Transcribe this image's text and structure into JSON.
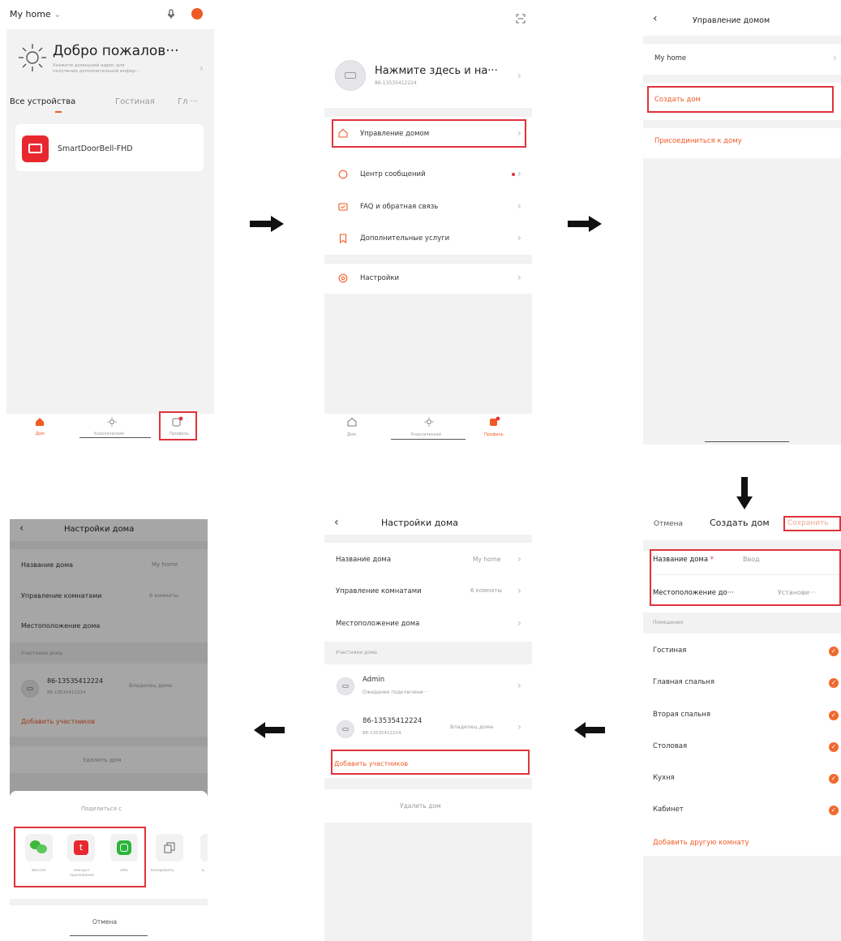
{
  "colors": {
    "accent": "#ef5a24",
    "highlight": "#e0333b"
  },
  "p1": {
    "home_selector": "My home",
    "chevron": "⌄",
    "welcome": "Добро пожалов···",
    "welcome_sub1": "Укажите домашний адрес для",
    "welcome_sub2": "получения дополнительной инфор···",
    "tabs": [
      "Все устройства",
      "Гостиная",
      "Гл ···"
    ],
    "device_name": "SmartDoorBell-FHD",
    "nav": [
      "Дом",
      "Классический",
      "Профиль"
    ]
  },
  "p2": {
    "profile_title": "Нажмите здесь и на···",
    "profile_sub": "86-13535412224",
    "menu": [
      "Управление домом",
      "Центр сообщений",
      "FAQ и обратная связь",
      "Дополнительные услуги"
    ],
    "settings": "Настройки",
    "nav": [
      "Дом",
      "Классический",
      "Профиль"
    ]
  },
  "p3": {
    "title": "Управление домом",
    "home": "My home",
    "create": "Создать дом",
    "join": "Присоединиться к дому"
  },
  "p4": {
    "cancel": "Отмена",
    "title": "Создать дом",
    "save": "Сохранить",
    "name_label": "Название дома",
    "name_placeholder": "Ввод",
    "location_label": "Местоположение до···",
    "location_value": "Установи···",
    "rooms_header": "Помещения",
    "rooms": [
      "Гостиная",
      "Главная спальня",
      "Вторая спальня",
      "Столовая",
      "Кухня",
      "Кабинет"
    ],
    "add_room": "Добавить другую комнату"
  },
  "p5": {
    "title": "Настройки дома",
    "home_name_label": "Название дома",
    "home_name_value": "My home",
    "rooms_label": "Управление комнатами",
    "rooms_value": "6 комнаты",
    "location_label": "Местоположение дома",
    "members_header": "Участники дома",
    "member1_name": "Admin",
    "member1_sub": "Ожидание подключени···",
    "member2_name": "86-13535412224",
    "member2_sub": "86-13535412224",
    "member2_role": "Владелец дома",
    "add_member": "Добавить участников",
    "delete_home": "Удалить дом"
  },
  "p6": {
    "title": "Настройки дома",
    "home_name_label": "Название дома",
    "home_name_value": "My home",
    "rooms_label": "Управление комнатами",
    "rooms_value": "6 комнаты",
    "location_label": "Местоположение дома",
    "members_header": "Участники дома",
    "member_name": "86-13535412224",
    "member_sub": "86-13535412224",
    "member_role": "Владелец дома",
    "add_member": "Добавить участников",
    "delete_home": "Удалить дом",
    "share_title": "Поделиться с",
    "share": [
      "WeChat",
      "Аккаунт приложения",
      "SMS",
      "Копировать",
      "Б"
    ],
    "cancel": "Отмена"
  }
}
